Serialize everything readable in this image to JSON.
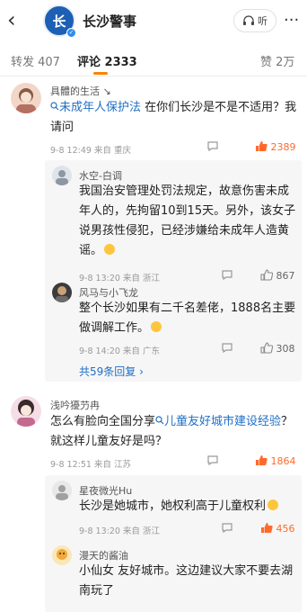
{
  "header": {
    "back_glyph": "‹",
    "logo_text": "长",
    "verified_glyph": "✓",
    "title": "长沙警事",
    "listen_label": "听",
    "more_glyph": "···"
  },
  "tabs": {
    "repost": "转发 407",
    "comment": "评论 2333",
    "like": "赞 2万"
  },
  "comments": [
    {
      "user": "具體的生活",
      "tag": "↘",
      "link": "未成年人保护法",
      "text_after": " 在你们长沙是不是不适用？我请问",
      "meta": "9-8 12:49 来自 重庆",
      "likes": "2389"
    },
    {
      "user": "水空-白调",
      "text": "我国治安管理处罚法规定，故意伤害未成年人的，先拘留10到15天。另外，该女子说男孩性侵犯，已经涉嫌给未成年人造黄谣。",
      "meta": "9-8 13:20 来自 浙江",
      "likes": "867"
    },
    {
      "user": "风马与小飞龙",
      "text": "整个长沙如果有二千名差佬，1888名主要做调解工作。",
      "meta": "9-8 14:20 来自 广东",
      "likes": "308"
    },
    {
      "more_replies": "共59条回复 ›"
    },
    {
      "user": "浅吟獶芀冉",
      "text_before": "怎么有脸向全国分享",
      "link": "儿童友好城市建设经验",
      "text_after": "？就这样儿童友好是吗？",
      "meta": "9-8 12:51 来自 江苏",
      "likes": "1864"
    },
    {
      "user": "星夜微光Hu",
      "text": "长沙是她城市，她权利高于儿童权利",
      "meta": "9-8 13:20 来自 浙江",
      "likes": "456"
    },
    {
      "user": "漫天的酱油",
      "text": "小仙女 友好城市。这边建议大家不要去湖南玩了"
    }
  ],
  "colors": {
    "accent_orange": "#ff8200",
    "hot_like": "#ff6a2b",
    "link_blue": "#1f6fc5",
    "reply_bg": "#f6f6f6"
  },
  "icons": [
    "back-arrow-icon",
    "verified-icon",
    "headphones-icon",
    "more-icon",
    "search-link-icon",
    "comment-icon",
    "thumb-up-icon"
  ]
}
